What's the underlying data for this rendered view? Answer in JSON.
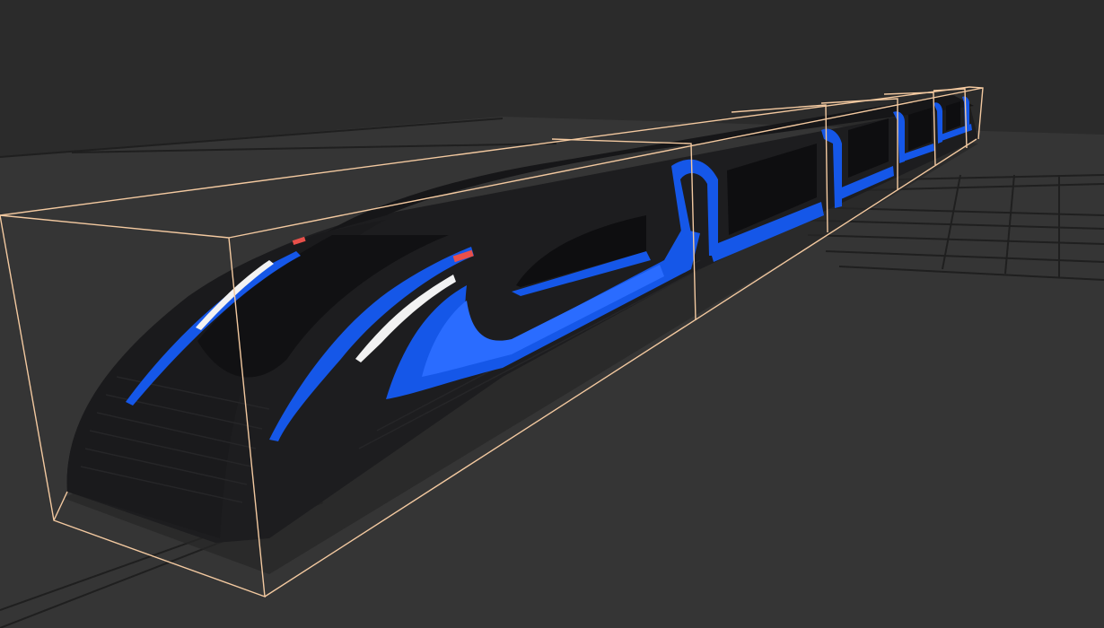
{
  "scene": {
    "background_color": "#2b2b2b",
    "floor_color": "#353535",
    "grid_line_color": "#1f1f1f",
    "selection_box_color": "#f3c9a0",
    "model_body_color": "#1d1d1f",
    "accent_blue": "#1557e8",
    "accent_blue_light": "#2a6cff",
    "accent_white": "#f2f2f2",
    "accent_red": "#e8504a",
    "segment_count": 5,
    "grid_visible": true,
    "selection_visible": true
  }
}
